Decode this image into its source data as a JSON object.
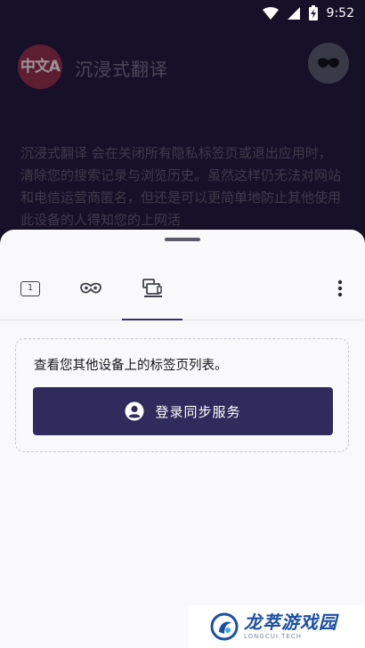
{
  "status_bar": {
    "time": "9:52"
  },
  "app": {
    "logo_text": "中文A",
    "title": "沉浸式翻译",
    "private_description": "沉浸式翻译 会在关闭所有隐私标签页或退出应用时，清除您的搜索记录与浏览历史。虽然这样仍无法对网站和电信运营商匿名，但还是可以更简单地防止其他使用此设备的人得知您的上网活"
  },
  "tab_tray": {
    "normal_tab_count": "1",
    "tabs": [
      {
        "icon": "tab-count-icon",
        "selected": false
      },
      {
        "icon": "private-mask-icon",
        "selected": false
      },
      {
        "icon": "synced-devices-icon",
        "selected": true
      }
    ],
    "menu_icon": "more-vertical-icon",
    "synced_panel": {
      "message": "查看您其他设备上的标签页列表。",
      "signin_button_label": "登录同步服务",
      "signin_icon": "account-icon"
    }
  },
  "watermark": {
    "title": "龙萃游戏园",
    "subtitle": "LONGCUI.TECH"
  },
  "colors": {
    "accent": "#312a5c",
    "tab_indicator": "#3b2c6b",
    "sheet_background": "#f9f9fb",
    "app_background": "#22183d"
  }
}
